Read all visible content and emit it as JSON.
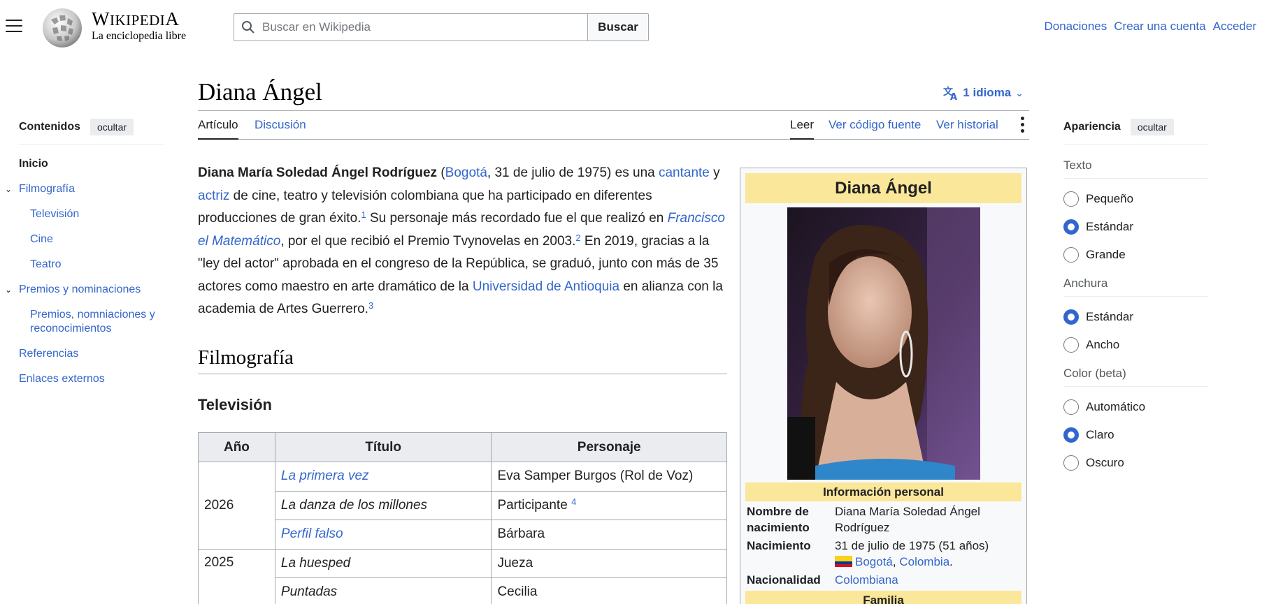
{
  "header": {
    "wordmark_w": "W",
    "wordmark_rest": "IKIPEDI",
    "wordmark_a": "A",
    "tagline": "La enciclopedia libre",
    "search_placeholder": "Buscar en Wikipedia",
    "search_button": "Buscar",
    "links": [
      "Donaciones",
      "Crear una cuenta",
      "Acceder"
    ]
  },
  "toc": {
    "title": "Contenidos",
    "hide": "ocultar",
    "items": [
      "Inicio",
      "Filmografía",
      "Televisión",
      "Cine",
      "Teatro",
      "Premios y nominaciones",
      "Premios, nomniaciones y reconocimientos",
      "Referencias",
      "Enlaces externos"
    ]
  },
  "page": {
    "title": "Diana Ángel",
    "languages": "1 idioma",
    "tabs": {
      "article": "Artículo",
      "discussion": "Discusión",
      "read": "Leer",
      "source": "Ver código fuente",
      "history": "Ver historial"
    }
  },
  "intro": {
    "name": "Diana María Soledad Ángel Rodríguez",
    "p1": " (",
    "bogota": "Bogotá",
    "p2": ", 31 de julio de 1975) es una ",
    "cantante": "cantante",
    "p3": " y ",
    "actriz": "actriz",
    "p4": " de cine, teatro y televisión colombiana que ha participado en diferentes producciones de gran éxito.",
    "ref1": "1",
    "p5": "  Su personaje más recordado fue el que realizó en ",
    "francisco": "Francisco el Matemático",
    "p6": ", por el que recibió el Premio Tvynovelas en 2003.",
    "ref2": "2",
    "p7": "  En 2019, gracias a la \"ley del actor\" aprobada en el congreso de la República, se graduó, junto con más de 35 actores como maestro en arte dramático de la ",
    "udea": "Universidad de Antioquia",
    "p8": " en alianza con la academia de Artes Guerrero.",
    "ref3": "3"
  },
  "sections": {
    "filmografia": "Filmografía",
    "television": "Televisión"
  },
  "table": {
    "headers": [
      "Año",
      "Título",
      "Personaje"
    ],
    "rows": [
      {
        "year": "2026",
        "title": "La primera vez",
        "role": "Eva Samper Burgos (Rol de Voz)"
      },
      {
        "title": "La danza de los millones",
        "role": "Participante",
        "ref": "4"
      },
      {
        "title": "Perfil falso",
        "role": "Bárbara"
      },
      {
        "year": "2025",
        "title": "La huesped",
        "role": "Jueza"
      },
      {
        "title": "Puntadas",
        "role": "Cecilia"
      }
    ]
  },
  "infobox": {
    "title": "Diana Ángel",
    "section_personal": "Información personal",
    "birth_name_label": "Nombre de nacimiento",
    "birth_name": "Diana María Soledad Ángel Rodríguez",
    "birth_label": "Nacimiento",
    "birth_date": "31 de julio de 1975 (51 años)",
    "birth_city": "Bogotá",
    "birth_country": "Colombia",
    "nationality_label": "Nacionalidad",
    "nationality": "Colombiana",
    "section_family": "Familia"
  },
  "appearance": {
    "title": "Apariencia",
    "hide": "ocultar",
    "groups": [
      {
        "label": "Texto",
        "options": [
          "Pequeño",
          "Estándar",
          "Grande"
        ],
        "selected": 1
      },
      {
        "label": "Anchura",
        "options": [
          "Estándar",
          "Ancho"
        ],
        "selected": 0
      },
      {
        "label": "Color (beta)",
        "options": [
          "Automático",
          "Claro",
          "Oscuro"
        ],
        "selected": 1
      }
    ]
  },
  "colors": {
    "link": "#3366cc",
    "infobox_header": "#fbe79a",
    "table_header": "#eaecf0"
  }
}
